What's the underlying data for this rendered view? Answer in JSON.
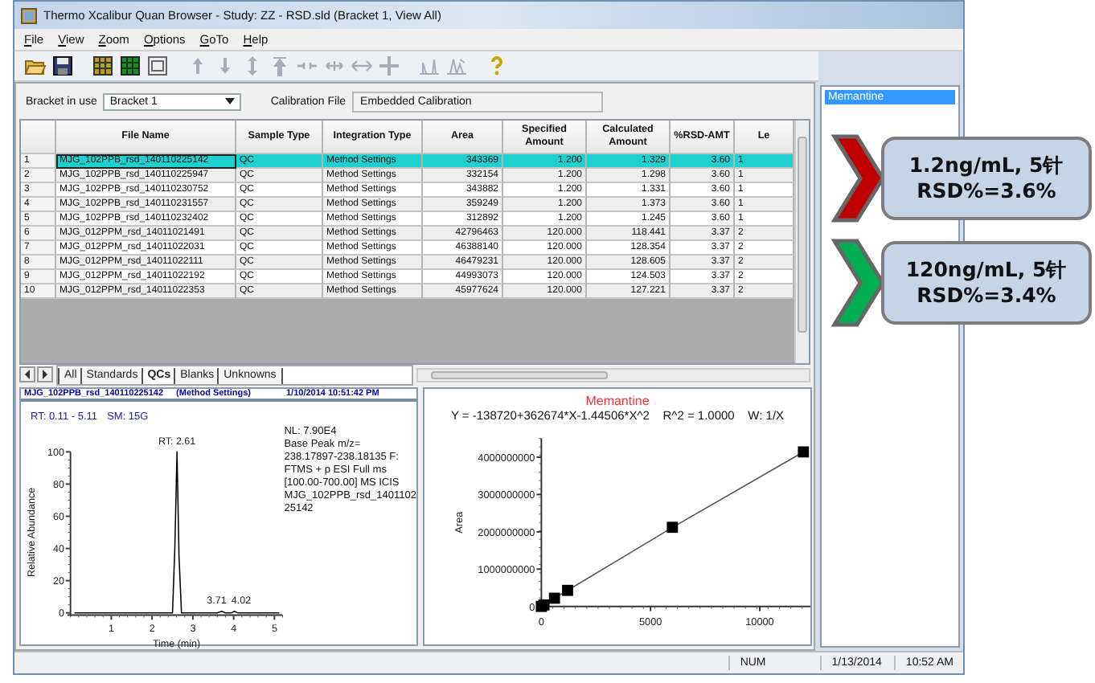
{
  "window": {
    "title": "Thermo Xcalibur Quan Browser - Study: ZZ - RSD.sld (Bracket 1, View All)"
  },
  "menu": [
    "File",
    "View",
    "Zoom",
    "Options",
    "GoTo",
    "Help"
  ],
  "toolbar": [
    {
      "kind": "folder"
    },
    {
      "kind": "save"
    },
    {
      "kind": "grid-gold"
    },
    {
      "kind": "grid-green"
    },
    {
      "kind": "window"
    },
    {
      "kind": "up"
    },
    {
      "kind": "down"
    },
    {
      "kind": "updown"
    },
    {
      "kind": "top"
    },
    {
      "kind": "shrink"
    },
    {
      "kind": "expand"
    },
    {
      "kind": "harrows"
    },
    {
      "kind": "cross"
    },
    {
      "kind": "peak"
    },
    {
      "kind": "peaks"
    },
    {
      "kind": "help"
    }
  ],
  "bracket": {
    "label": "Bracket in use",
    "value": "Bracket 1"
  },
  "calibration_file": {
    "label": "Calibration File",
    "value": "Embedded Calibration"
  },
  "table": {
    "columns": [
      "File Name",
      "Sample Type",
      "Integration Type",
      "Area",
      "Specified Amount",
      "Calculated Amount",
      "%RSD-AMT",
      "Le"
    ],
    "rows": [
      {
        "number": "1",
        "selected": true,
        "cells": [
          "MJG_102PPB_rsd_140110225142",
          "QC",
          "Method Settings",
          "343369",
          "1.200",
          "1.329",
          "3.60",
          "1"
        ]
      },
      {
        "number": "2",
        "selected": false,
        "cells": [
          "MJG_102PPB_rsd_140110225947",
          "QC",
          "Method Settings",
          "332154",
          "1.200",
          "1.298",
          "3.60",
          "1"
        ]
      },
      {
        "number": "3",
        "selected": false,
        "cells": [
          "MJG_102PPB_rsd_140110230752",
          "QC",
          "Method Settings",
          "343882",
          "1.200",
          "1.331",
          "3.60",
          "1"
        ]
      },
      {
        "number": "4",
        "selected": false,
        "cells": [
          "MJG_102PPB_rsd_140110231557",
          "QC",
          "Method Settings",
          "359249",
          "1.200",
          "1.373",
          "3.60",
          "1"
        ]
      },
      {
        "number": "5",
        "selected": false,
        "cells": [
          "MJG_102PPB_rsd_140110232402",
          "QC",
          "Method Settings",
          "312892",
          "1.200",
          "1.245",
          "3.60",
          "1"
        ]
      },
      {
        "number": "6",
        "selected": false,
        "cells": [
          "MJG_012PPM_rsd_14011021491",
          "QC",
          "Method Settings",
          "42796463",
          "120.000",
          "118.441",
          "3.37",
          "2"
        ]
      },
      {
        "number": "7",
        "selected": false,
        "cells": [
          "MJG_012PPM_rsd_14011022031",
          "QC",
          "Method Settings",
          "46388140",
          "120.000",
          "128.354",
          "3.37",
          "2"
        ]
      },
      {
        "number": "8",
        "selected": false,
        "cells": [
          "MJG_012PPM_rsd_14011022111",
          "QC",
          "Method Settings",
          "46479231",
          "120.000",
          "128.605",
          "3.37",
          "2"
        ]
      },
      {
        "number": "9",
        "selected": false,
        "cells": [
          "MJG_012PPM_rsd_14011022192",
          "QC",
          "Method Settings",
          "44993073",
          "120.000",
          "124.503",
          "3.37",
          "2"
        ]
      },
      {
        "number": "10",
        "selected": false,
        "cells": [
          "MJG_012PPM_rsd_14011022353",
          "QC",
          "Method Settings",
          "45977624",
          "120.000",
          "127.221",
          "3.37",
          "2"
        ]
      }
    ]
  },
  "sheet_tabs": [
    {
      "label": "All",
      "selected": false
    },
    {
      "label": "Standards",
      "selected": false
    },
    {
      "label": "QCs",
      "selected": true
    },
    {
      "label": "Blanks",
      "selected": false
    },
    {
      "label": "Unknowns",
      "selected": false
    }
  ],
  "chromatogram": {
    "file": "MJG_102PPB_rsd_140110225142",
    "method": "(Method Settings)",
    "datetime": "1/10/2014 10:51:42 PM",
    "range": "RT: 0.11 - 5.11",
    "smoothing": "SM: 15G",
    "info": [
      "NL: 7.90E4",
      "Base Peak m/z=",
      "238.17897-238.18135 F:",
      "FTMS + p ESI Full ms",
      "[100.00-700.00]  MS  ICIS",
      "MJG_102PPB_rsd_1401102",
      "25142"
    ],
    "chart_data": {
      "type": "line",
      "xlabel": "Time (min)",
      "ylabel": "Relative Abundance",
      "x": [
        0.11,
        2.5,
        2.56,
        2.61,
        2.66,
        2.72,
        3.6,
        3.71,
        3.8,
        3.95,
        4.02,
        4.1,
        5.11
      ],
      "series": [
        {
          "color": "#000000",
          "values": [
            0,
            0,
            40,
            100,
            35,
            0,
            0,
            1,
            0,
            0,
            1,
            0,
            0
          ]
        }
      ],
      "xlim": [
        0,
        5.2
      ],
      "ylim": [
        0,
        100
      ],
      "xticks": [
        1,
        2,
        3,
        4,
        5
      ],
      "yticks": [
        0,
        20,
        40,
        60,
        80,
        100
      ],
      "annotations": [
        {
          "x": 2.61,
          "y": 100,
          "text": "RT: 2.61"
        },
        {
          "x": 3.71,
          "y": 1,
          "text": "3.71"
        },
        {
          "x": 4.02,
          "y": 1,
          "text": "4.02"
        }
      ]
    }
  },
  "calibration": {
    "equation": "Y = -138720+362674*X-1.44506*X^2    R^2 = 1.0000    W: 1/X",
    "chart_data": {
      "type": "scatter",
      "title": "Memantine",
      "ylabel": "Area",
      "x": [
        1.2,
        120,
        600,
        1200,
        6000,
        12000
      ],
      "series": [
        {
          "color": "#000000",
          "values": [
            0,
            40000000,
            220000000,
            430000000,
            2120000000,
            4140000000
          ]
        },
        {
          "type": "line",
          "color": "#555555",
          "values": [
            0,
            40000000,
            220000000,
            430000000,
            2120000000,
            4140000000
          ]
        }
      ],
      "xlim": [
        0,
        13500
      ],
      "ylim": [
        0,
        4500000000
      ],
      "xticks": [
        0,
        5000,
        10000
      ],
      "yticks": [
        0,
        1000000000,
        2000000000,
        3000000000,
        4000000000
      ]
    }
  },
  "compound_list": [
    {
      "label": "Memantine",
      "selected": true
    }
  ],
  "status_bar": {
    "mode": "NUM",
    "date": "1/13/2014",
    "time": "10:52 AM"
  },
  "callouts": [
    {
      "lines": [
        "1.2ng/mL, 5针",
        "RSD%=3.6%"
      ],
      "color": "#c00000"
    },
    {
      "lines": [
        "120ng/mL, 5针",
        "RSD%=3.4%"
      ],
      "color": "#00b050"
    }
  ]
}
